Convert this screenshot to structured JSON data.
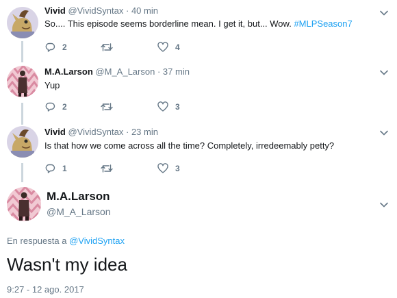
{
  "tweets": [
    {
      "name": "Vivid",
      "handle": "@VividSyntax",
      "dot": "·",
      "time": "40 min",
      "text": "So.... This episode seems borderline mean. I get it, but... Wow. ",
      "hashtag": "#MLPSeason7",
      "reply_count": "2",
      "retweet_count": "",
      "like_count": "4"
    },
    {
      "name": "M.A.Larson",
      "handle": "@M_A_Larson",
      "dot": "·",
      "time": "37 min",
      "text": "Yup",
      "reply_count": "2",
      "retweet_count": "",
      "like_count": "3"
    },
    {
      "name": "Vivid",
      "handle": "@VividSyntax",
      "dot": "·",
      "time": "23 min",
      "text": "Is that how we come across all the time? Completely, irredeemably petty?",
      "reply_count": "1",
      "retweet_count": "",
      "like_count": "3"
    }
  ],
  "main_tweet": {
    "name": "M.A.Larson",
    "handle": "@M_A_Larson",
    "reply_prefix": "En respuesta a ",
    "reply_link": "@VividSyntax",
    "text": "Wasn't my idea",
    "timestamp": "9:27 - 12 ago. 2017"
  },
  "icons": {
    "reply": "reply-icon",
    "retweet": "retweet-icon",
    "like": "heart-icon",
    "menu": "chevron-down-icon"
  },
  "colors": {
    "link": "#1da1f2",
    "muted": "#657786",
    "thread_line": "#ccd6dd",
    "text": "#14171a"
  }
}
